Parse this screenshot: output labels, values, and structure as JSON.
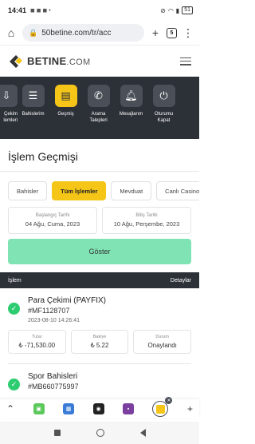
{
  "status_bar": {
    "time": "14:41",
    "battery": "51"
  },
  "browser": {
    "url": "50betine.com/tr/acc",
    "tab_count": "5"
  },
  "site": {
    "logo_main": "BETINE",
    "logo_suffix": ".COM"
  },
  "nav": [
    {
      "label": "Çekim\nlemleri",
      "icon": "withdraw-icon"
    },
    {
      "label": "Bahislerim",
      "icon": "document-icon"
    },
    {
      "label": "Geçmiş",
      "icon": "wallet-icon",
      "active": true
    },
    {
      "label": "Arama\nTalepleri",
      "icon": "phone-icon"
    },
    {
      "label": "Mesajlarım",
      "icon": "bell-icon"
    },
    {
      "label": "Oturumu\nKapat",
      "icon": "power-icon"
    }
  ],
  "page_title": "İşlem Geçmişi",
  "filters": [
    "Bahisler",
    "Tüm İşlemler",
    "Mevduat",
    "Canlı Casino"
  ],
  "dates": {
    "start_label": "Başlangıç Tarihi",
    "start_value": "04 Ağu, Cuma, 2023",
    "end_label": "Bitiş Tarihi",
    "end_value": "10 Ağu, Perşembe, 2023"
  },
  "show_button": "Göster",
  "list_header": {
    "left": "İşlem",
    "right": "Detaylar"
  },
  "transactions": [
    {
      "title": "Para Çekimi (PAYFIX)",
      "ref": "#MF1128707",
      "date": "2023-08-10 14:26:41",
      "amount_label": "Tutar",
      "amount": "₺ -71,530.00",
      "balance_label": "Bakiye",
      "balance": "₺ 5.22",
      "status_label": "Durum",
      "status": "Onaylandı"
    },
    {
      "title": "Spor Bahisleri",
      "ref": "#MB660775997"
    }
  ],
  "colors": {
    "accent": "#f5c518",
    "dark": "#2c3037",
    "success": "#2ecc71",
    "button": "#7fe3b4"
  }
}
